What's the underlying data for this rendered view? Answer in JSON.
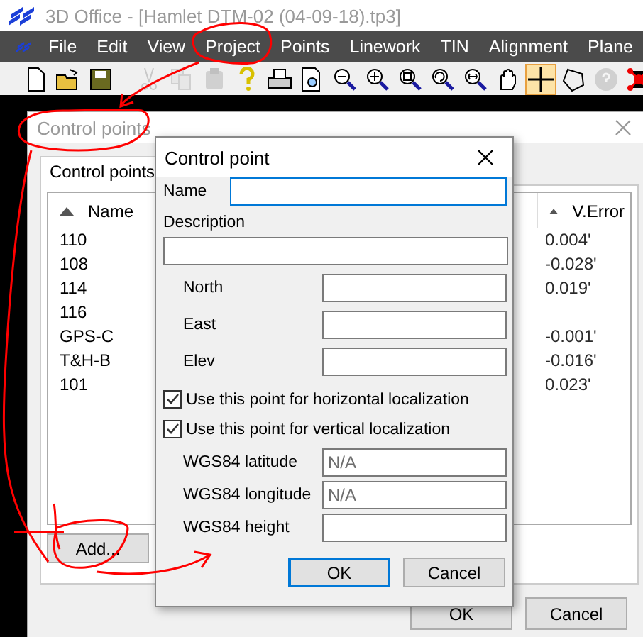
{
  "window": {
    "title": "3D Office - [Hamlet DTM-02 (04-09-18).tp3]"
  },
  "menu": [
    "File",
    "Edit",
    "View",
    "Project",
    "Points",
    "Linework",
    "TIN",
    "Alignment",
    "Plane"
  ],
  "toolbar": [
    {
      "kind": "new",
      "disabled": false,
      "selected": false
    },
    {
      "kind": "open",
      "disabled": false,
      "selected": false
    },
    {
      "kind": "save",
      "disabled": false,
      "selected": false
    },
    {
      "kind": "separator"
    },
    {
      "kind": "cut",
      "disabled": true,
      "selected": false
    },
    {
      "kind": "copy",
      "disabled": true,
      "selected": false
    },
    {
      "kind": "paste",
      "disabled": true,
      "selected": false
    },
    {
      "kind": "help",
      "disabled": false,
      "selected": false
    },
    {
      "kind": "print",
      "disabled": false,
      "selected": false
    },
    {
      "kind": "preview",
      "disabled": false,
      "selected": false
    },
    {
      "kind": "zoom-out",
      "disabled": false,
      "selected": false
    },
    {
      "kind": "zoom-in",
      "disabled": false,
      "selected": false
    },
    {
      "kind": "zoom-window",
      "disabled": false,
      "selected": false
    },
    {
      "kind": "zoom-previous",
      "disabled": false,
      "selected": false
    },
    {
      "kind": "zoom-extents",
      "disabled": false,
      "selected": false
    },
    {
      "kind": "pan",
      "disabled": false,
      "selected": false
    },
    {
      "kind": "crosshair",
      "disabled": false,
      "selected": true
    },
    {
      "kind": "polygon",
      "disabled": false,
      "selected": false
    },
    {
      "kind": "info",
      "disabled": true,
      "selected": false
    },
    {
      "kind": "network",
      "disabled": false,
      "selected": false
    }
  ],
  "control_points_dialog": {
    "title": "Control points",
    "tabs": [
      {
        "label": "Control points",
        "selected": true
      }
    ],
    "columns": [
      "Name",
      "V.Error"
    ],
    "rows": [
      {
        "name": "110",
        "v_error": "0.004'"
      },
      {
        "name": "108",
        "v_error": "-0.028'"
      },
      {
        "name": "114",
        "v_error": "0.019'"
      },
      {
        "name": "116"
      },
      {
        "name": "GPS-C",
        "v_error": "-0.001'"
      },
      {
        "name": "T&H-B",
        "v_error": "-0.016'"
      },
      {
        "name": "101",
        "v_error": "0.023'"
      }
    ],
    "add_button": "Add...",
    "ok_button": "OK",
    "cancel_button": "Cancel"
  },
  "control_point_dialog": {
    "title": "Control point",
    "name_label": "Name",
    "description_label": "Description",
    "coordinates": [
      {
        "label": "North"
      },
      {
        "label": "East"
      },
      {
        "label": "Elev"
      }
    ],
    "checkboxes": [
      {
        "label": "Use this point for horizontal localization",
        "checked": true
      },
      {
        "label": "Use this point for vertical localization",
        "checked": true
      }
    ],
    "wgs84": [
      {
        "label": "WGS84 latitude",
        "value": "N/A"
      },
      {
        "label": "WGS84 longitude",
        "value": "N/A"
      },
      {
        "label": "WGS84 height"
      }
    ],
    "ok_button": "OK",
    "cancel_button": "Cancel"
  }
}
